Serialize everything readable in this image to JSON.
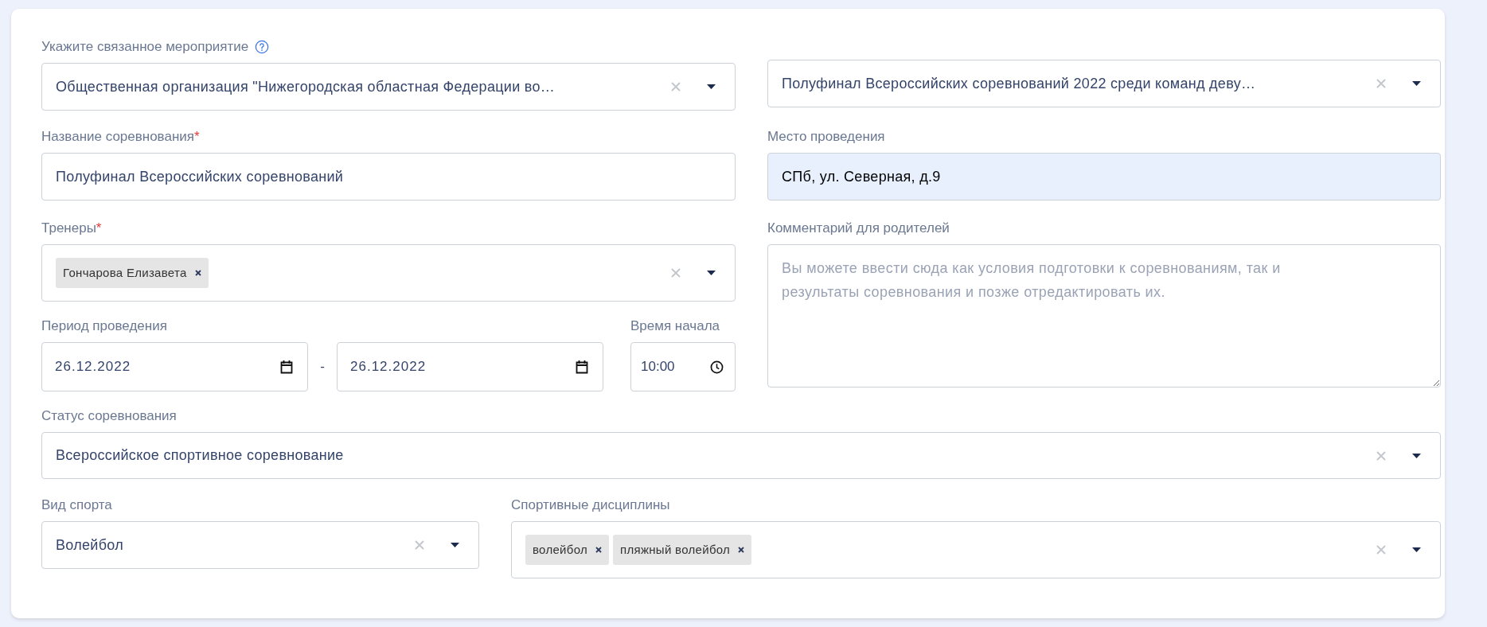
{
  "event": {
    "label": "Укажите связанное мероприятие",
    "help": true,
    "organization": {
      "value": "Общественная организация \"Нижегородская областная Федерации во…"
    },
    "competition": {
      "value": "Полуфинал Всероссийских соревнований 2022 среди команд деву…"
    }
  },
  "name": {
    "label": "Название соревнования",
    "required_mark": "*",
    "value": "Полуфинал Всероссийских соревнований"
  },
  "place": {
    "label": "Место проведения",
    "value": "СПб, ул. Северная, д.9",
    "autofilled": true
  },
  "coaches": {
    "label": "Тренеры",
    "required_mark": "*",
    "chips": [
      "Гончарова Елизавета"
    ]
  },
  "comment": {
    "label": "Комментарий для родителей",
    "placeholder": "Вы можете ввести сюда как условия подготовки к соревнованиям, так и результаты соревнования и позже отредактировать их."
  },
  "period": {
    "label": "Период проведения",
    "start": "26.12.2022",
    "separator": "-",
    "end": "26.12.2022"
  },
  "start_time": {
    "label": "Время начала",
    "value": "10:00"
  },
  "status": {
    "label": "Статус соревнования",
    "value": "Всероссийское спортивное соревнование"
  },
  "sport": {
    "label": "Вид спорта",
    "value": "Волейбол"
  },
  "disciplines": {
    "label": "Спортивные дисциплины",
    "chips": [
      "волейбол",
      "пляжный волейбол"
    ]
  }
}
